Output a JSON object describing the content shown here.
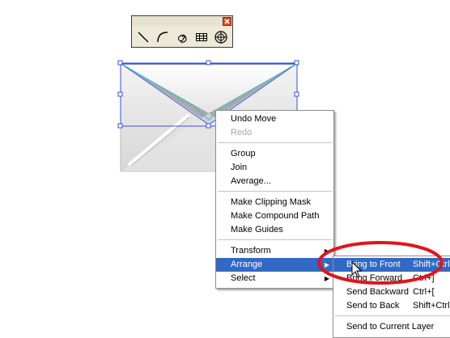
{
  "palette": {
    "close_icon": "close-icon",
    "tools": [
      {
        "name": "line-segment-tool-icon"
      },
      {
        "name": "arc-tool-icon"
      },
      {
        "name": "spiral-tool-icon"
      },
      {
        "name": "rectangular-grid-tool-icon"
      },
      {
        "name": "polar-grid-tool-icon"
      }
    ]
  },
  "context_menu": {
    "undo_move": "Undo Move",
    "redo": "Redo",
    "group": "Group",
    "join": "Join",
    "average": "Average...",
    "make_clipping_mask": "Make Clipping Mask",
    "make_compound_path": "Make Compound Path",
    "make_guides": "Make Guides",
    "transform": "Transform",
    "arrange": "Arrange",
    "select": "Select"
  },
  "arrange_submenu": {
    "items": [
      {
        "label": "Bring to Front",
        "shortcut": "Shift+Ctrl+]"
      },
      {
        "label": "Bring Forward",
        "shortcut": "Ctrl+]"
      },
      {
        "label": "Send Backward",
        "shortcut": "Ctrl+["
      },
      {
        "label": "Send to Back",
        "shortcut": "Shift+Ctrl+["
      },
      {
        "label": "Send to Current Layer",
        "shortcut": ""
      }
    ]
  },
  "colors": {
    "selection": "#3b4fd8",
    "highlight": "#316ac5",
    "annotation": "#e0141e"
  }
}
